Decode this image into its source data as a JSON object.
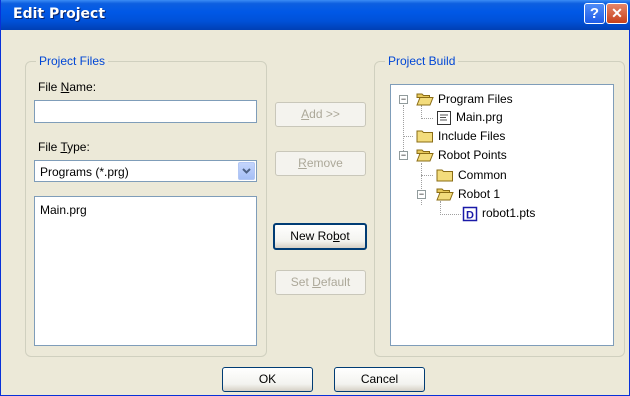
{
  "window": {
    "title": "Edit Project",
    "help_glyph": "?",
    "close_glyph": "✕"
  },
  "project_files": {
    "legend": "Project Files",
    "file_name_label": "File Name:",
    "file_name_value": "",
    "file_type_label": "File Type:",
    "file_type_selected": "Programs (*.prg)",
    "files": [
      "Main.prg"
    ]
  },
  "buttons": {
    "add": "Add >>",
    "remove": "Remove",
    "new_robot": "New Robot",
    "set_default": "Set Default",
    "ok": "OK",
    "cancel": "Cancel"
  },
  "project_build": {
    "legend": "Project Build",
    "tree": [
      {
        "label": "Program Files",
        "icon": "folder-open-icon",
        "expander": "−"
      },
      {
        "label": "Main.prg",
        "icon": "program-file-icon"
      },
      {
        "label": "Include Files",
        "icon": "folder-icon"
      },
      {
        "label": "Robot Points",
        "icon": "folder-open-icon",
        "expander": "−"
      },
      {
        "label": "Common",
        "icon": "folder-icon"
      },
      {
        "label": "Robot 1",
        "icon": "folder-open-icon",
        "expander": "−"
      },
      {
        "label": "robot1.pts",
        "icon": "points-file-icon"
      }
    ]
  },
  "colors": {
    "titlebar": "#0058e6",
    "dialog": "#ece9d8",
    "legend": "#0046d5",
    "field_border": "#7f9db9"
  }
}
